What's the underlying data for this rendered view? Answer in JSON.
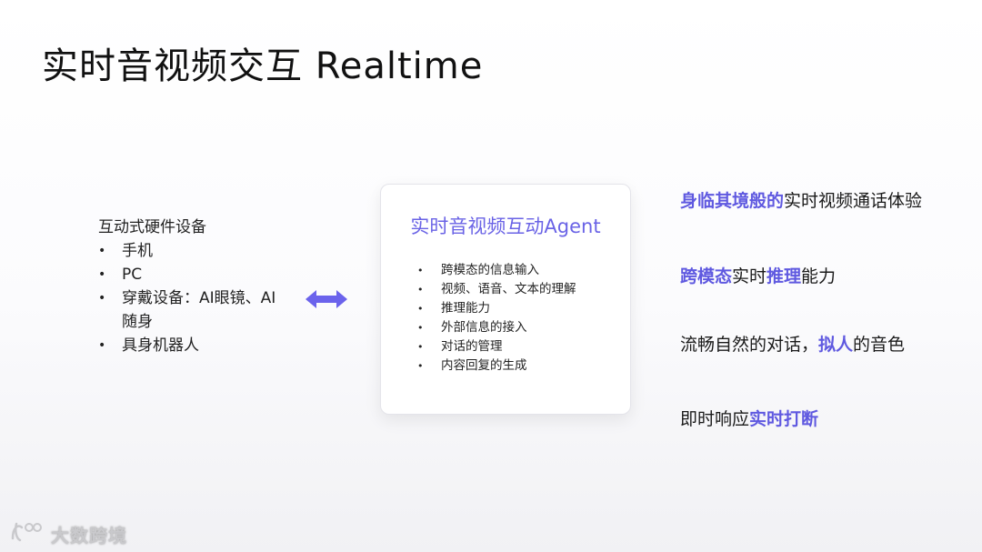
{
  "title": "实时音视频交互 Realtime",
  "left": {
    "heading": "互动式硬件设备",
    "items": [
      "手机",
      "PC",
      "穿戴设备：AI眼镜、AI随身",
      "具身机器人"
    ]
  },
  "arrow_icon": "double-arrow-icon",
  "card": {
    "title": "实时音视频互动Agent",
    "items": [
      "跨模态的信息输入",
      "视频、语音、文本的理解",
      "推理能力",
      "外部信息的接入",
      "对话的管理",
      "内容回复的生成"
    ]
  },
  "features": [
    {
      "parts": [
        {
          "text": "身临其境般的",
          "highlight": true
        },
        {
          "text": "实时视频通话体验",
          "highlight": false
        }
      ]
    },
    {
      "parts": [
        {
          "text": "跨模态",
          "highlight": true
        },
        {
          "text": "实时",
          "highlight": false
        },
        {
          "text": "推理",
          "highlight": true
        },
        {
          "text": "能力",
          "highlight": false
        }
      ]
    },
    {
      "parts": [
        {
          "text": "流畅自然的对话，",
          "highlight": false
        },
        {
          "text": "拟人",
          "highlight": true
        },
        {
          "text": "的音色",
          "highlight": false
        }
      ]
    },
    {
      "parts": [
        {
          "text": "即时响应",
          "highlight": false
        },
        {
          "text": "实时打断",
          "highlight": true
        }
      ]
    }
  ],
  "watermark": {
    "text": "大数跨境",
    "icon": "brand-logo-icon"
  },
  "colors": {
    "accent": "#6a63e6",
    "highlight": "#5f59e0",
    "arrow": "#6b63ec"
  }
}
